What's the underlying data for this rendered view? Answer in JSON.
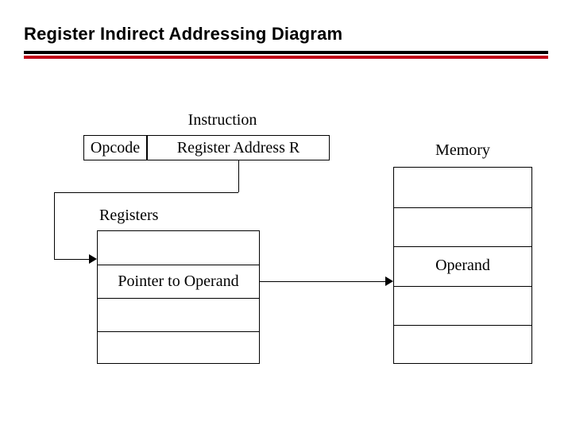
{
  "title": "Register Indirect Addressing Diagram",
  "instruction": {
    "heading": "Instruction",
    "opcode": "Opcode",
    "reg_address": "Register Address R"
  },
  "registers": {
    "heading": "Registers",
    "rows": [
      "",
      "Pointer to Operand",
      "",
      ""
    ]
  },
  "memory": {
    "heading": "Memory",
    "rows": [
      "",
      "",
      "Operand",
      "",
      ""
    ]
  }
}
